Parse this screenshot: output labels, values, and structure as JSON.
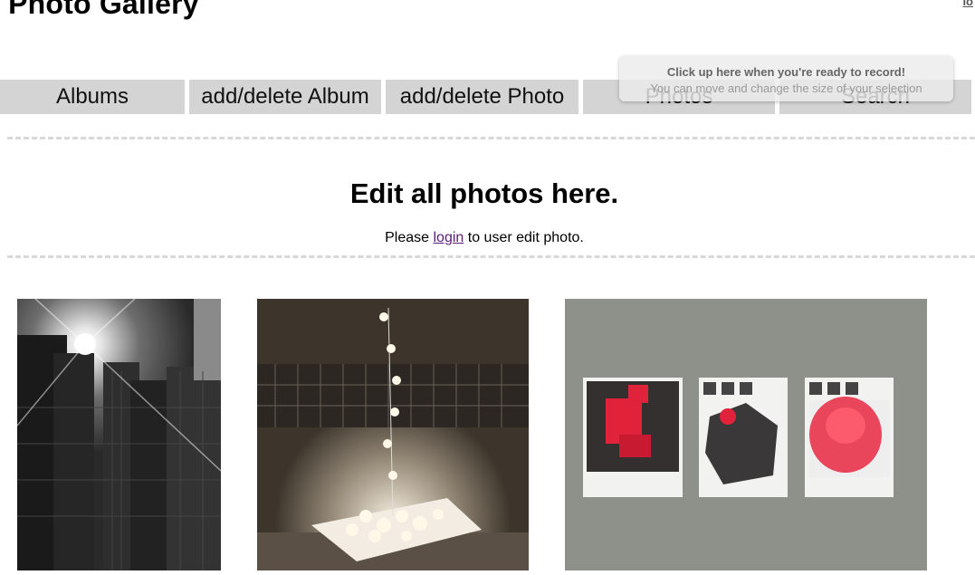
{
  "header": {
    "title": "y Photo Gallery",
    "corner_link": "lo"
  },
  "nav": {
    "items": [
      {
        "label": "Albums"
      },
      {
        "label": "add/delete Album"
      },
      {
        "label": "add/delete Photo"
      },
      {
        "label": "Photos"
      },
      {
        "label": "Search"
      }
    ]
  },
  "main": {
    "heading": "Edit all photos here.",
    "login_prefix": "Please",
    "login_link": "login",
    "login_suffix": "to user edit photo."
  },
  "photos": [
    {
      "subject": "black and white skyscrapers with sun flare"
    },
    {
      "subject": "string of lights sculpture on white base"
    },
    {
      "subject": "three framed red map posters on gray wall"
    }
  ],
  "record_overlay": {
    "title": "Click up here when you're ready to record!",
    "subtitle": "You can move and change the size of your selection"
  }
}
